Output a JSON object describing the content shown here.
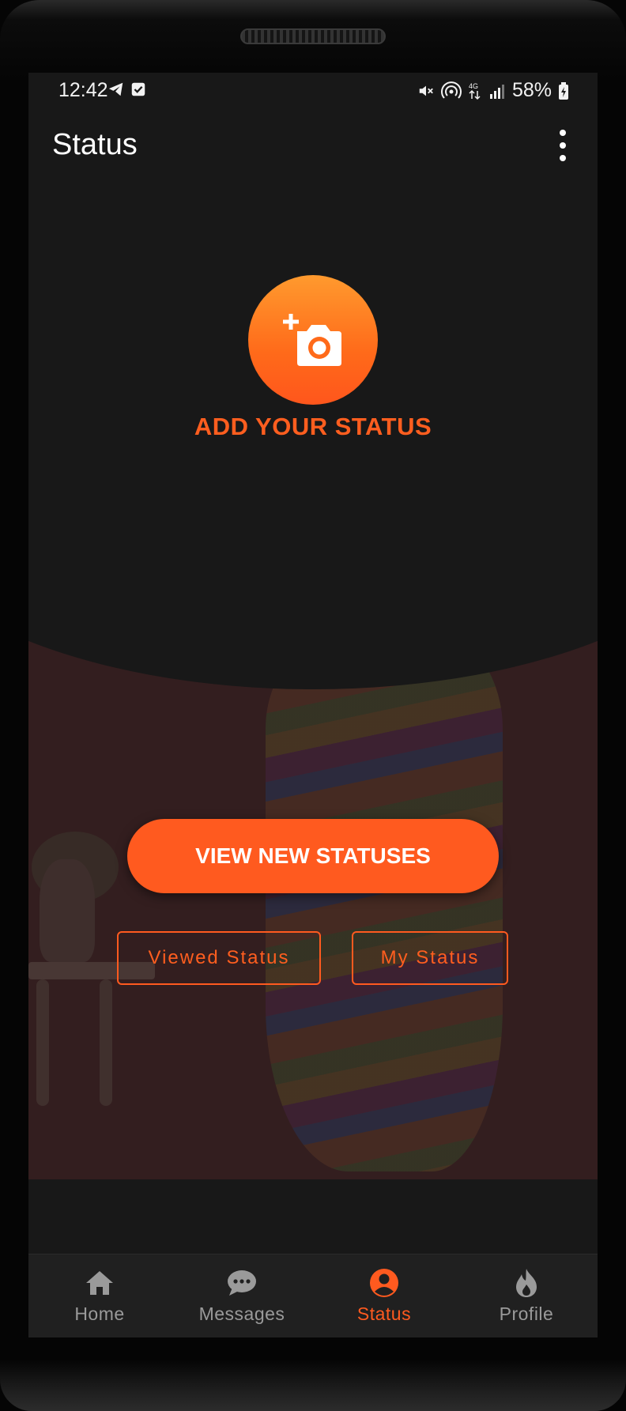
{
  "status_bar": {
    "time": "12:42",
    "battery": "58%",
    "network": "4G"
  },
  "app_bar": {
    "title": "Status"
  },
  "add_status": {
    "label": "ADD YOUR STATUS"
  },
  "actions": {
    "view_new_label": "VIEW NEW STATUSES",
    "viewed_label": "Viewed Status",
    "my_status_label": "My Status"
  },
  "bottom_nav": {
    "items": [
      {
        "label": "Home",
        "icon": "home-icon"
      },
      {
        "label": "Messages",
        "icon": "chat-bubble-icon"
      },
      {
        "label": "Status",
        "icon": "account-circle-icon",
        "active": true
      },
      {
        "label": "Profile",
        "icon": "flame-icon"
      }
    ]
  },
  "colors": {
    "accent": "#ff5a1f",
    "background": "#181818",
    "nav_inactive": "#9a9a9a"
  }
}
